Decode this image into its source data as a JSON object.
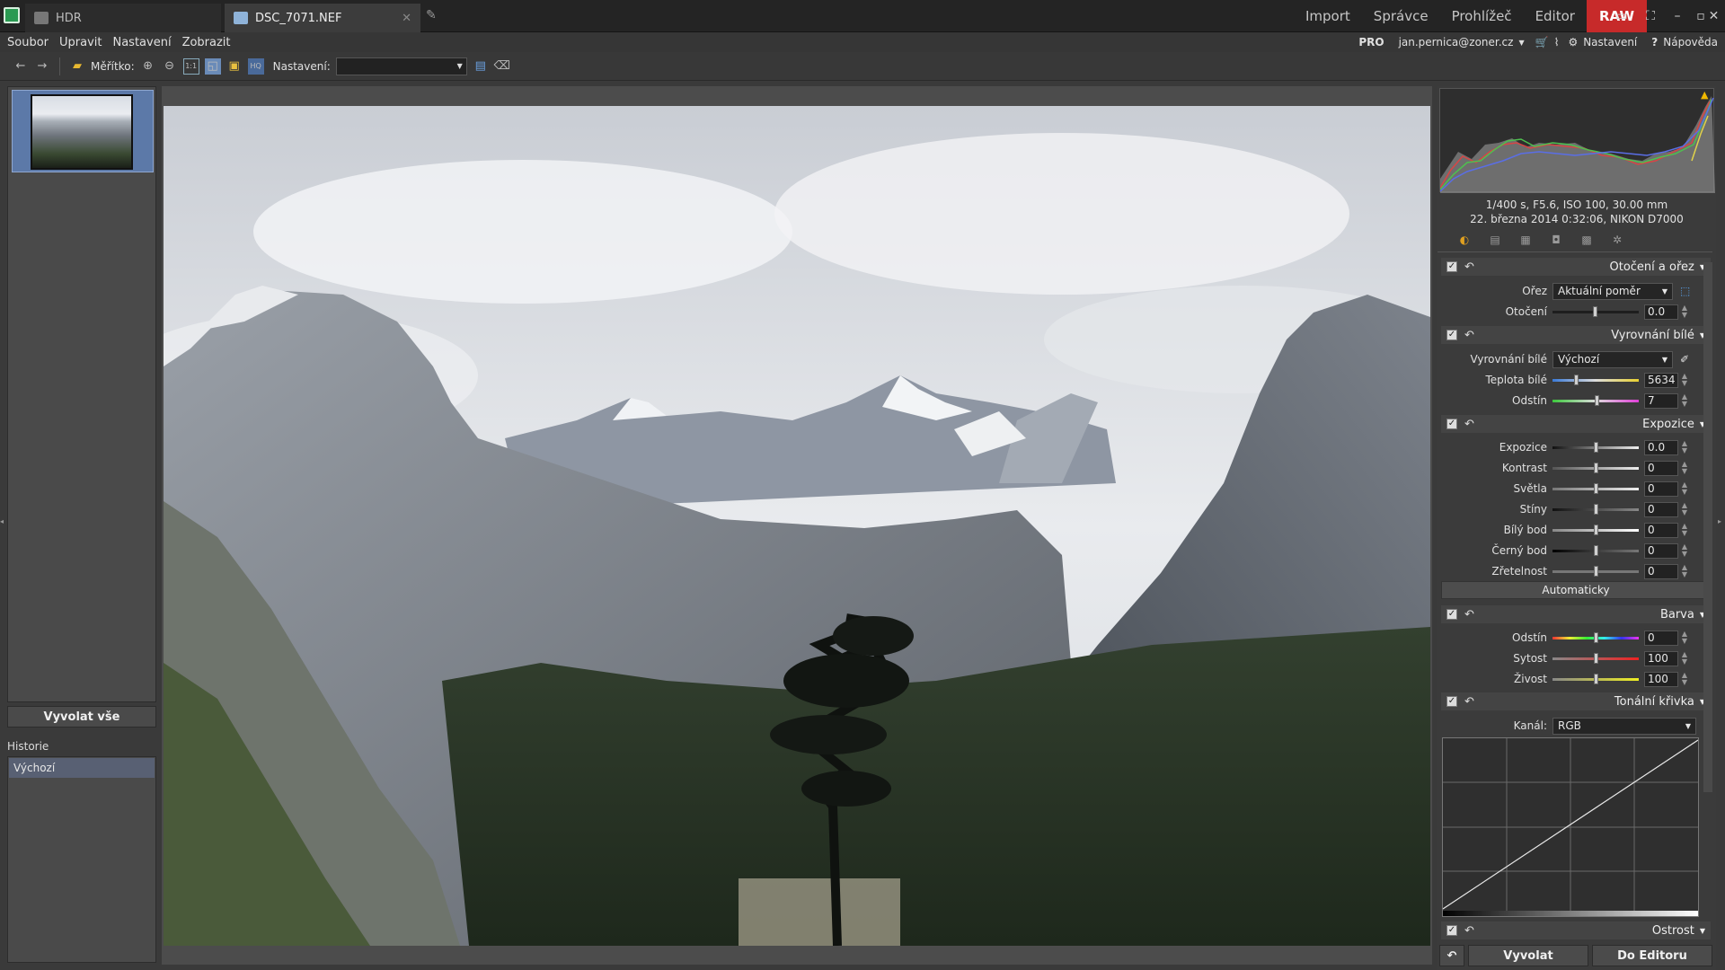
{
  "title_bar": {
    "tabs": [
      {
        "label": "HDR",
        "icon": "hdr-icon"
      },
      {
        "label": "DSC_7071.NEF",
        "icon": "image-icon",
        "close": "✕"
      }
    ],
    "modes": [
      "Import",
      "Správce",
      "Prohlížeč",
      "Editor",
      "RAW"
    ],
    "active_mode": "RAW",
    "accent_color": "#c72a2a"
  },
  "menu": {
    "items": [
      "Soubor",
      "Upravit",
      "Nastavení",
      "Zobrazit"
    ],
    "right": {
      "pro": "PRO",
      "account": "jan.pernica@zoner.cz",
      "settings": "Nastavení",
      "help": "Nápověda"
    }
  },
  "toolbar": {
    "scale_label": "Měřítko:",
    "preset_label": "Nastavení:",
    "preset_value": ""
  },
  "left": {
    "develop_all": "Vyvolat vše",
    "history_title": "Historie",
    "history_items": [
      "Výchozí"
    ]
  },
  "right": {
    "exif_line1": "1/400 s, F5.6, ISO 100, 30.00 mm",
    "exif_line2": "22. března 2014 0:32:06, NIKON D7000",
    "sections": {
      "crop": {
        "title": "Otočení a ořez",
        "crop_label": "Ořez",
        "crop_value": "Aktuální poměr",
        "rotate_label": "Otočení",
        "rotate_value": "0.0"
      },
      "wb": {
        "title": "Vyrovnání bílé",
        "wb_label": "Vyrovnání bílé",
        "wb_value": "Výchozí",
        "temp_label": "Teplota bílé",
        "temp_value": "5634",
        "tint_label": "Odstín",
        "tint_value": "7"
      },
      "exposure": {
        "title": "Expozice",
        "rows": [
          {
            "label": "Expozice",
            "value": "0.0"
          },
          {
            "label": "Kontrast",
            "value": "0"
          },
          {
            "label": "Světla",
            "value": "0"
          },
          {
            "label": "Stíny",
            "value": "0"
          },
          {
            "label": "Bílý bod",
            "value": "0"
          },
          {
            "label": "Černý bod",
            "value": "0"
          },
          {
            "label": "Zřetelnost",
            "value": "0"
          }
        ],
        "auto": "Automaticky"
      },
      "color": {
        "title": "Barva",
        "rows": [
          {
            "label": "Odstín",
            "value": "0"
          },
          {
            "label": "Sytost",
            "value": "100"
          },
          {
            "label": "Živost",
            "value": "100"
          }
        ]
      },
      "curve": {
        "title": "Tonální křivka",
        "channel_label": "Kanál:",
        "channel_value": "RGB"
      },
      "sharpen": {
        "title": "Ostrost"
      }
    },
    "develop": "Vyvolat",
    "to_editor": "Do Editoru"
  }
}
